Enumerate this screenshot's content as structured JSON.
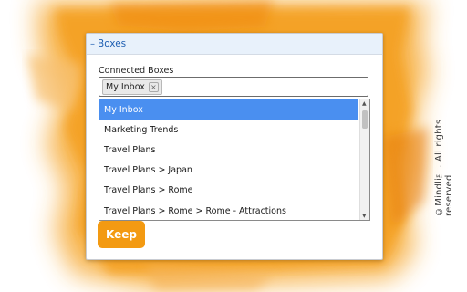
{
  "copyright": "©Mindli™. All rights reserved",
  "panel": {
    "header_title": "Boxes",
    "field_label": "Connected Boxes",
    "selected_tags": [
      "My Inbox"
    ],
    "tag_remove_glyph": "×",
    "options": [
      "My Inbox",
      "Marketing Trends",
      "Travel Plans",
      "Travel Plans > Japan",
      "Travel Plans > Rome",
      "Travel Plans > Rome > Rome - Attractions"
    ],
    "highlighted_option_index": 0,
    "keep_label": "Keep"
  },
  "colors": {
    "accent_orange": "#f39a12",
    "selected_blue": "#4a8ff0",
    "header_text": "#1f5fb2"
  }
}
